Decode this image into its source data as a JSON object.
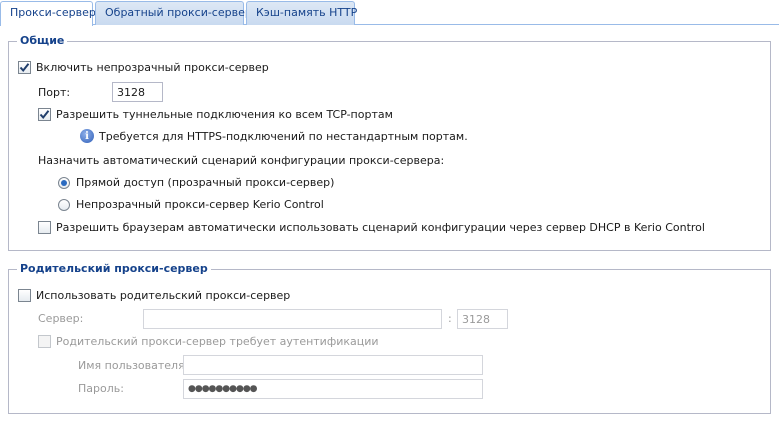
{
  "tabs": [
    {
      "label": "Прокси-сервер",
      "active": true
    },
    {
      "label": "Обратный прокси-сервер",
      "active": false
    },
    {
      "label": "Кэш-память HTTP",
      "active": false
    }
  ],
  "general": {
    "title": "Общие",
    "enable_proxy": {
      "label": "Включить непрозрачный прокси-сервер",
      "checked": true
    },
    "port_label": "Порт:",
    "port_value": "3128",
    "allow_tunnel": {
      "label": "Разрешить туннельные подключения ко всем TCP-портам",
      "checked": true
    },
    "info_text": "Требуется для HTTPS-подключений по нестандартным портам.",
    "auto_script_label": "Назначить автоматический сценарий конфигурации прокси-сервера:",
    "radio_direct": {
      "label": "Прямой доступ (прозрачный прокси-сервер)",
      "selected": true
    },
    "radio_kerio": {
      "label": "Непрозрачный прокси-сервер Kerio Control",
      "selected": false
    },
    "allow_dhcp": {
      "label": "Разрешить браузерам автоматически использовать сценарий конфигурации через сервер DHCP в Kerio Control",
      "checked": false
    }
  },
  "parent": {
    "title": "Родительский прокси-сервер",
    "use_parent": {
      "label": "Использовать родительский прокси-сервер",
      "checked": false
    },
    "server_label": "Сервер:",
    "server_value": "",
    "separator": ":",
    "port_value": "3128",
    "auth_required": {
      "label": "Родительский прокси-сервер требует аутентификации",
      "checked": false
    },
    "username_label": "Имя пользователя:",
    "username_value": "",
    "password_label": "Пароль:",
    "password_value": "●●●●●●●●●●"
  },
  "colors": {
    "accent": "#15428b",
    "tab_border": "#99bbe8",
    "group_border": "#b5b8c8"
  }
}
